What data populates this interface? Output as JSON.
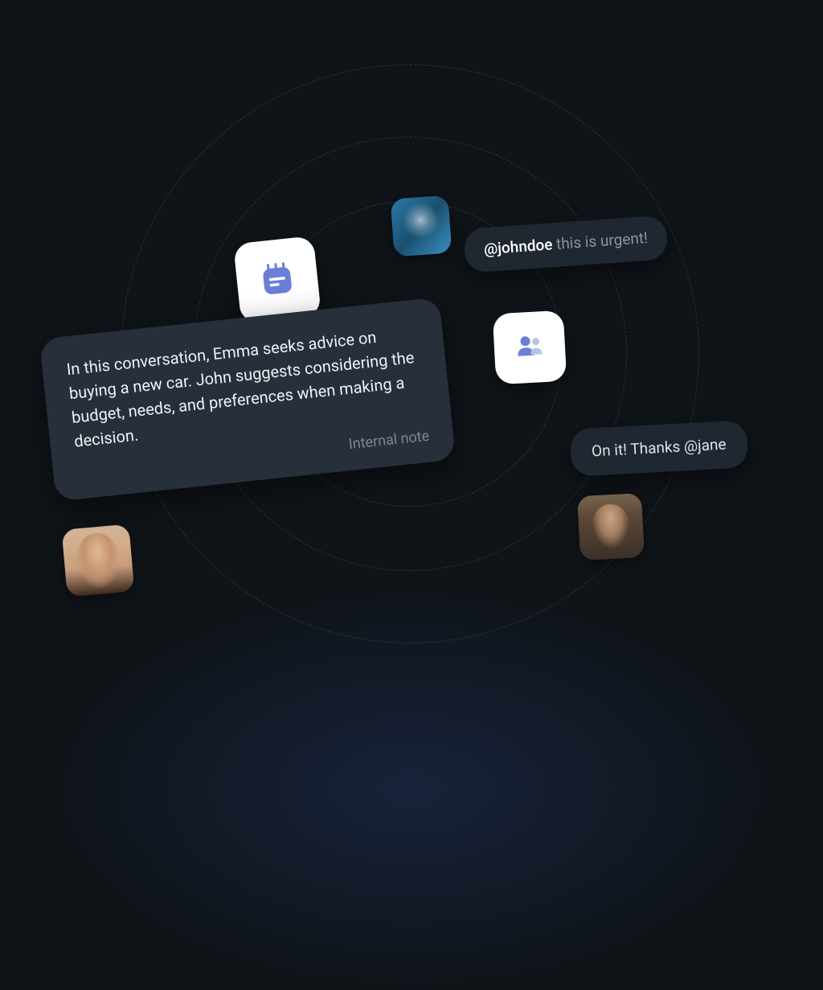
{
  "bubbles": {
    "urgent": {
      "mention": "@johndoe",
      "text": " this is urgent!"
    },
    "reply": {
      "text": "On it! Thanks @jane"
    }
  },
  "note": {
    "body": "In this conversation, Emma seeks advice on buying a new car. John suggests considering the budget, needs, and preferences when making a decision.",
    "label": "Internal note"
  },
  "icons": {
    "notes": "notes-icon",
    "people": "people-icon"
  },
  "avatars": {
    "top": "user-jane",
    "right": "user-john",
    "left": "user-emma"
  }
}
